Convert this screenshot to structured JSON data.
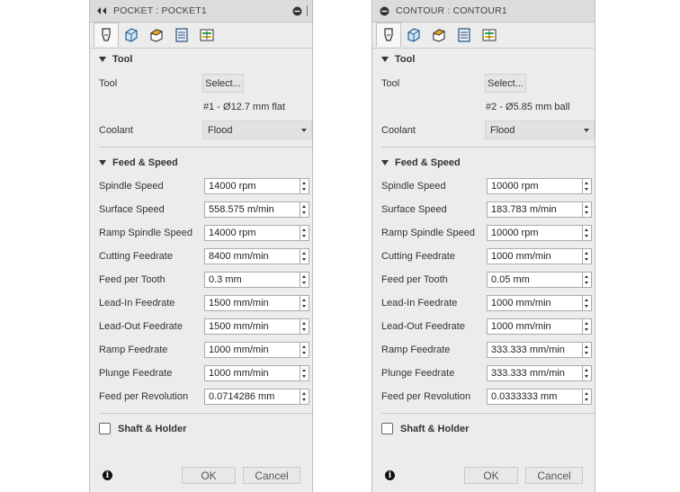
{
  "common": {
    "tool_section": "Tool",
    "tool_label": "Tool",
    "select_button": "Select...",
    "coolant_label": "Coolant",
    "feed_section": "Feed & Speed",
    "shaft_holder": "Shaft & Holder",
    "ok": "OK",
    "cancel": "Cancel",
    "info_glyph": "i",
    "labels": {
      "spindle_speed": "Spindle Speed",
      "surface_speed": "Surface Speed",
      "ramp_spindle_speed": "Ramp Spindle Speed",
      "cutting_feedrate": "Cutting Feedrate",
      "feed_per_tooth": "Feed per Tooth",
      "lead_in_feedrate": "Lead-In Feedrate",
      "lead_out_feedrate": "Lead-Out Feedrate",
      "ramp_feedrate": "Ramp Feedrate",
      "plunge_feedrate": "Plunge Feedrate",
      "feed_per_revolution": "Feed per Revolution"
    },
    "tab_icons": [
      "tool-tab-icon",
      "geometry-tab-icon",
      "heights-tab-icon",
      "passes-tab-icon",
      "linking-tab-icon"
    ]
  },
  "left": {
    "title": "POCKET : POCKET1",
    "tool_name": "#1 - Ø12.7 mm flat",
    "coolant": "Flood",
    "spindle_speed": "14000 rpm",
    "surface_speed": "558.575 m/min",
    "ramp_spindle_speed": "14000 rpm",
    "cutting_feedrate": "8400 mm/min",
    "feed_per_tooth": "0.3 mm",
    "lead_in_feedrate": "1500 mm/min",
    "lead_out_feedrate": "1500 mm/min",
    "ramp_feedrate": "1000 mm/min",
    "plunge_feedrate": "1000 mm/min",
    "feed_per_revolution": "0.0714286 mm",
    "shaft_holder_checked": false
  },
  "right": {
    "title": "CONTOUR : CONTOUR1",
    "tool_name": "#2 - Ø5.85 mm ball",
    "coolant": "Flood",
    "spindle_speed": "10000 rpm",
    "surface_speed": "183.783 m/min",
    "ramp_spindle_speed": "10000 rpm",
    "cutting_feedrate": "1000 mm/min",
    "feed_per_tooth": "0.05 mm",
    "lead_in_feedrate": "1000 mm/min",
    "lead_out_feedrate": "1000 mm/min",
    "ramp_feedrate": "333.333 mm/min",
    "plunge_feedrate": "333.333 mm/min",
    "feed_per_revolution": "0.0333333 mm",
    "shaft_holder_checked": false
  }
}
